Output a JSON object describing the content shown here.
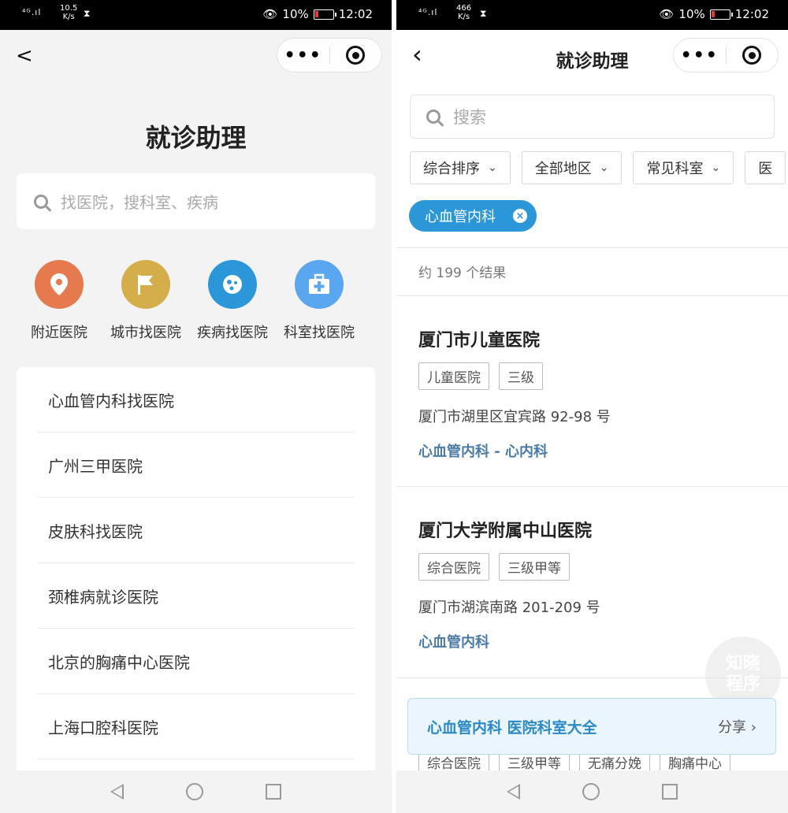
{
  "status_left": {
    "signal": "⁴ᴳ.ıl",
    "speed_val": "10.5",
    "speed_unit": "K/s",
    "battery": "10%",
    "time": "12:02"
  },
  "status_right": {
    "signal": "⁴ᴳ.ıl",
    "speed_val": "466",
    "speed_unit": "K/s",
    "battery": "10%",
    "time": "12:02"
  },
  "left": {
    "title": "就诊助理",
    "search_placeholder": "找医院，搜科室、疾病",
    "categories": [
      {
        "label": "附近医院",
        "icon": "location-pin-icon",
        "color": "#e57a4e"
      },
      {
        "label": "城市找医院",
        "icon": "flag-icon",
        "color": "#d4ae4a"
      },
      {
        "label": "疾病找医院",
        "icon": "virus-icon",
        "color": "#2b97d9"
      },
      {
        "label": "科室找医院",
        "icon": "medical-kit-icon",
        "color": "#5aa7ef"
      }
    ],
    "suggestions": [
      "心血管内科找医院",
      "广州三甲医院",
      "皮肤科找医院",
      "颈椎病就诊医院",
      "北京的胸痛中心医院",
      "上海口腔科医院"
    ]
  },
  "right": {
    "title": "就诊助理",
    "search_placeholder": "搜索",
    "filters": [
      "综合排序",
      "全部地区",
      "常见科室",
      "医"
    ],
    "chip": "心血管内科",
    "result_count": "约 199 个结果",
    "hospitals": [
      {
        "name": "厦门市儿童医院",
        "tags": [
          "儿童医院",
          "三级"
        ],
        "address": "厦门市湖里区宜宾路 92-98 号",
        "dept": "心血管内科 - 心内科"
      },
      {
        "name": "厦门大学附属中山医院",
        "tags": [
          "综合医院",
          "三级甲等"
        ],
        "address": "厦门市湖滨南路 201-209 号",
        "dept": "心血管内科"
      }
    ],
    "peek_tags": [
      "综合医院",
      "三级甲等",
      "无痛分娩",
      "胸痛中心"
    ],
    "banner_text": "心血管内科 医院科室大全",
    "banner_share": "分享",
    "watermark": "知晓程序"
  }
}
